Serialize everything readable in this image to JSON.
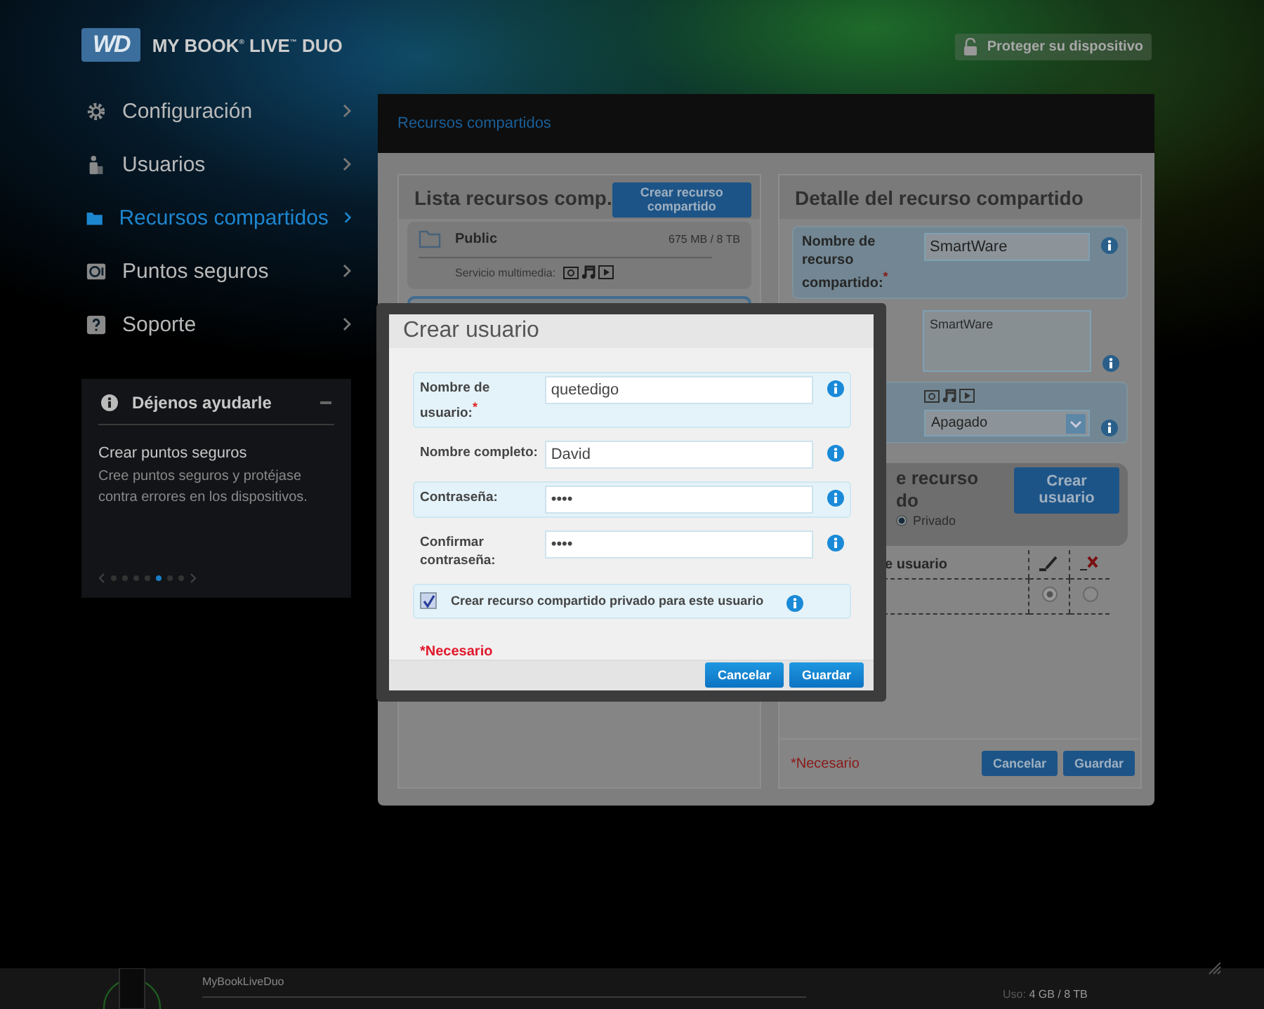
{
  "header": {
    "logo": "WD",
    "product": "MY BOOK$^{®}$ LIVE$^{™}$ DUO",
    "protect_button": "Proteger su dispositivo"
  },
  "sidebar": {
    "items": [
      {
        "label": "Configuración",
        "kind": "gear",
        "selected": false
      },
      {
        "label": "Usuarios",
        "kind": "user",
        "selected": false
      },
      {
        "label": "Recursos compartidos",
        "kind": "folder",
        "selected": true
      },
      {
        "label": "Puntos seguros",
        "kind": "safe",
        "selected": false
      },
      {
        "label": "Soporte",
        "kind": "help",
        "selected": false
      }
    ],
    "help": {
      "title": "Déjenos ayudarle",
      "heading": "Crear puntos seguros",
      "text": "Cree puntos seguros y protéjase contra errores en los dispositivos.",
      "pages": [
        {
          "selected": false
        },
        {
          "selected": false
        },
        {
          "selected": false
        },
        {
          "selected": false
        },
        {
          "selected": true
        },
        {
          "selected": false
        },
        {
          "selected": false
        }
      ]
    }
  },
  "main": {
    "title": "Recursos compartidos",
    "share_list": {
      "title": "Lista recursos comp.",
      "create_button": "Crear recurso compartido",
      "items": [
        {
          "name": "Public",
          "usage": "675 MB / 8 TB",
          "media_label": "Servicio multimedia:",
          "selected": false
        },
        {
          "selected": true
        }
      ]
    },
    "detail": {
      "title": "Detalle del recurso compartido",
      "name_label": "Nombre de recurso compartido:$^{*}$",
      "name_value": "SmartWare",
      "description_value": "SmartWare",
      "media_select": "Apagado",
      "access_title": [
        "e recurso",
        "do"
      ],
      "create_user_button": "Crear usuario",
      "access_option": {
        "label": "Privado",
        "selected": true
      },
      "users_table": {
        "column_1": "e usuario",
        "rows": [
          {
            "cells": [
              {
                "selected": true
              },
              {
                "selected": false
              }
            ]
          }
        ]
      },
      "required_note": "*Necesario",
      "buttons": [
        "Cancelar",
        "Guardar"
      ]
    }
  },
  "modal": {
    "title": "Crear usuario",
    "fields": [
      {
        "label": "Nombre de usuario:$^{*}$",
        "value": "quetedigo"
      },
      {
        "label": "Nombre completo:",
        "value": "David"
      },
      {
        "label": "Contraseña:",
        "value": "••••"
      },
      {
        "label": "Confirmar contraseña:",
        "value": "••••"
      }
    ],
    "checkbox": {
      "label": "Crear recurso compartido privado para este usuario",
      "checked": true
    },
    "required_note": "*Necesario",
    "buttons": [
      "Cancelar",
      "Guardar"
    ]
  },
  "status_bar": {
    "device_name": "MyBookLiveDuo",
    "usage_label": "Uso:",
    "usage_value": "4 GB / 8 TB"
  }
}
